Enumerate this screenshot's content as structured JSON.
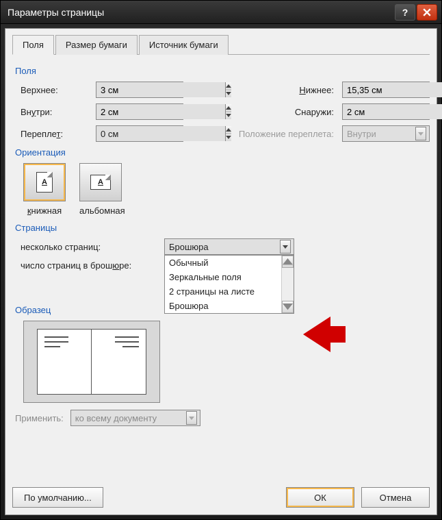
{
  "title": "Параметры страницы",
  "tabs": [
    "Поля",
    "Размер бумаги",
    "Источник бумаги"
  ],
  "active_tab": 0,
  "sections": {
    "fields": "Поля",
    "orientation": "Ориентация",
    "pages": "Страницы",
    "preview": "Образец"
  },
  "margins": {
    "top": {
      "label": "Верхнее:",
      "underline": "В",
      "value": "3 см"
    },
    "bottom": {
      "label": "Нижнее:",
      "underline": "Н",
      "value": "15,35 см"
    },
    "inside": {
      "label": "Внутри:",
      "underline": "В",
      "value": "2 см"
    },
    "outside": {
      "label": "Снаружи:",
      "value": "2 см"
    },
    "gutter": {
      "label": "Переплет:",
      "underline": "т",
      "value": "0 см"
    },
    "gutter_pos": {
      "label": "Положение переплета:",
      "value": "Внутри",
      "disabled": true
    }
  },
  "orientation": {
    "portrait": {
      "label": "книжная",
      "active": true
    },
    "landscape": {
      "label": "альбомная",
      "active": false
    }
  },
  "pages": {
    "multi_label": "несколько страниц:",
    "multi_value": "Брошюра",
    "options": [
      "Обычный",
      "Зеркальные поля",
      "2 страницы на листе",
      "Брошюра"
    ],
    "sheets_label": "число страниц в брошюре:",
    "sheets_underline": "ю"
  },
  "apply": {
    "label": "Применить:",
    "value": "ко всему документу",
    "disabled": true
  },
  "buttons": {
    "default": "По умолчанию...",
    "ok": "ОК",
    "cancel": "Отмена"
  }
}
